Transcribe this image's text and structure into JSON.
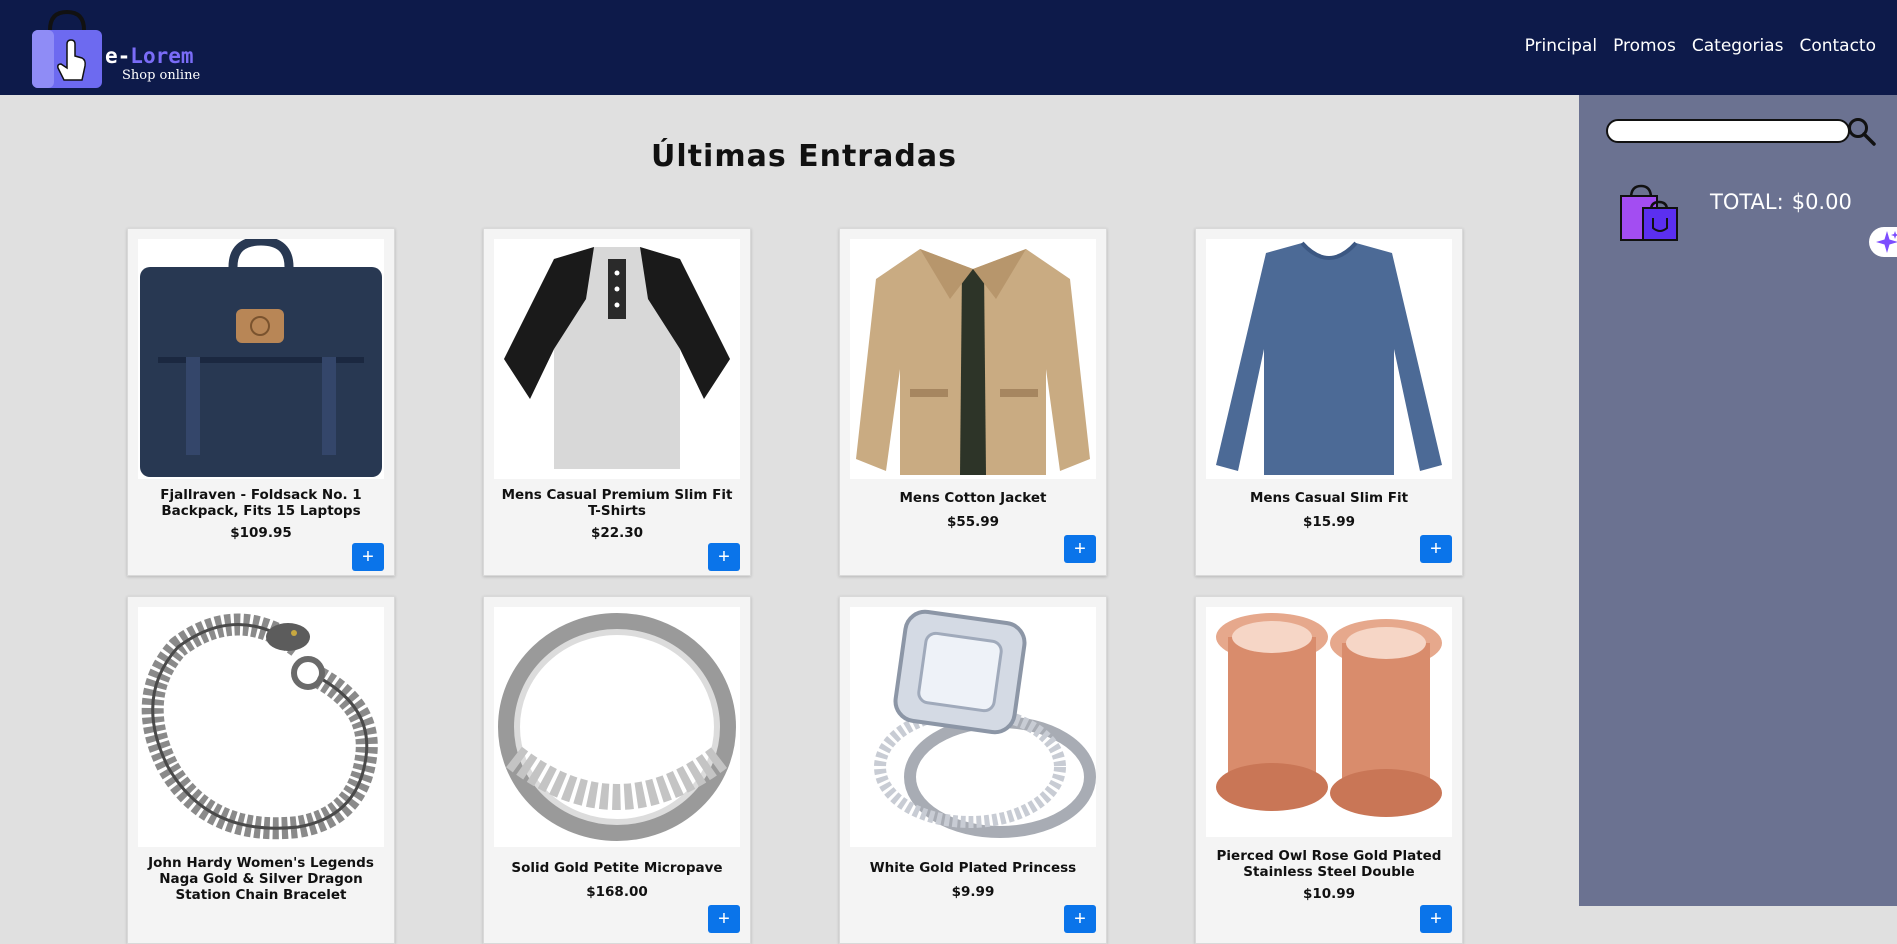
{
  "header": {
    "logo_prefix": "e-",
    "logo_name": "Lorem",
    "logo_tagline": "Shop online",
    "nav": [
      "Principal",
      "Promos",
      "Categorias",
      "Contacto"
    ]
  },
  "main": {
    "title": "Últimas Entradas",
    "add_label": "+",
    "products": [
      {
        "name": "Fjallraven - Foldsack No. 1 Backpack, Fits 15 Laptops",
        "price": "$109.95",
        "image": "navy-backpack"
      },
      {
        "name": "Mens Casual Premium Slim Fit T-Shirts",
        "price": "$22.30",
        "image": "raglan-henley-shirt"
      },
      {
        "name": "Mens Cotton Jacket",
        "price": "$55.99",
        "image": "khaki-jacket"
      },
      {
        "name": "Mens Casual Slim Fit",
        "price": "$15.99",
        "image": "blue-long-sleeve-shirt"
      },
      {
        "name": "John Hardy Women's Legends Naga Gold & Silver Dragon Station Chain Bracelet",
        "price": "",
        "image": "dragon-chain-bracelet"
      },
      {
        "name": "Solid Gold Petite Micropave",
        "price": "$168.00",
        "image": "silver-ring"
      },
      {
        "name": "White Gold Plated Princess",
        "price": "$9.99",
        "image": "diamond-ring-set"
      },
      {
        "name": "Pierced Owl Rose Gold Plated Stainless Steel Double",
        "price": "$10.99",
        "image": "rose-gold-plugs"
      }
    ]
  },
  "sidebar": {
    "search_placeholder": "",
    "total_label": "TOTAL:",
    "total_value": "$0.00"
  },
  "colors": {
    "header_bg": "#0d1a4a",
    "sidebar_bg": "#6b7291",
    "page_bg": "#e0e0e0",
    "accent_button": "#0a74ea",
    "logo_accent": "#7a6cf7"
  },
  "icons": [
    "shopping-bag-hand-icon",
    "search-icon",
    "cart-bags-icon",
    "sparkle-icon"
  ]
}
